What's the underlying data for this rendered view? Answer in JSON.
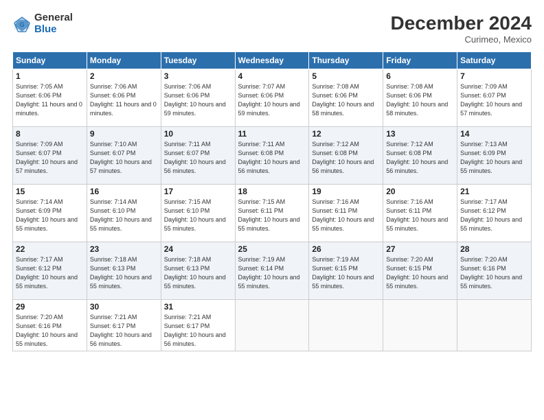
{
  "logo": {
    "general": "General",
    "blue": "Blue"
  },
  "header": {
    "month": "December 2024",
    "location": "Curimeo, Mexico"
  },
  "weekdays": [
    "Sunday",
    "Monday",
    "Tuesday",
    "Wednesday",
    "Thursday",
    "Friday",
    "Saturday"
  ],
  "weeks": [
    [
      {
        "day": "1",
        "sunrise": "7:05 AM",
        "sunset": "6:06 PM",
        "daylight": "11 hours and 0 minutes."
      },
      {
        "day": "2",
        "sunrise": "7:06 AM",
        "sunset": "6:06 PM",
        "daylight": "11 hours and 0 minutes."
      },
      {
        "day": "3",
        "sunrise": "7:06 AM",
        "sunset": "6:06 PM",
        "daylight": "10 hours and 59 minutes."
      },
      {
        "day": "4",
        "sunrise": "7:07 AM",
        "sunset": "6:06 PM",
        "daylight": "10 hours and 59 minutes."
      },
      {
        "day": "5",
        "sunrise": "7:08 AM",
        "sunset": "6:06 PM",
        "daylight": "10 hours and 58 minutes."
      },
      {
        "day": "6",
        "sunrise": "7:08 AM",
        "sunset": "6:06 PM",
        "daylight": "10 hours and 58 minutes."
      },
      {
        "day": "7",
        "sunrise": "7:09 AM",
        "sunset": "6:07 PM",
        "daylight": "10 hours and 57 minutes."
      }
    ],
    [
      {
        "day": "8",
        "sunrise": "7:09 AM",
        "sunset": "6:07 PM",
        "daylight": "10 hours and 57 minutes."
      },
      {
        "day": "9",
        "sunrise": "7:10 AM",
        "sunset": "6:07 PM",
        "daylight": "10 hours and 57 minutes."
      },
      {
        "day": "10",
        "sunrise": "7:11 AM",
        "sunset": "6:07 PM",
        "daylight": "10 hours and 56 minutes."
      },
      {
        "day": "11",
        "sunrise": "7:11 AM",
        "sunset": "6:08 PM",
        "daylight": "10 hours and 56 minutes."
      },
      {
        "day": "12",
        "sunrise": "7:12 AM",
        "sunset": "6:08 PM",
        "daylight": "10 hours and 56 minutes."
      },
      {
        "day": "13",
        "sunrise": "7:12 AM",
        "sunset": "6:08 PM",
        "daylight": "10 hours and 56 minutes."
      },
      {
        "day": "14",
        "sunrise": "7:13 AM",
        "sunset": "6:09 PM",
        "daylight": "10 hours and 55 minutes."
      }
    ],
    [
      {
        "day": "15",
        "sunrise": "7:14 AM",
        "sunset": "6:09 PM",
        "daylight": "10 hours and 55 minutes."
      },
      {
        "day": "16",
        "sunrise": "7:14 AM",
        "sunset": "6:10 PM",
        "daylight": "10 hours and 55 minutes."
      },
      {
        "day": "17",
        "sunrise": "7:15 AM",
        "sunset": "6:10 PM",
        "daylight": "10 hours and 55 minutes."
      },
      {
        "day": "18",
        "sunrise": "7:15 AM",
        "sunset": "6:11 PM",
        "daylight": "10 hours and 55 minutes."
      },
      {
        "day": "19",
        "sunrise": "7:16 AM",
        "sunset": "6:11 PM",
        "daylight": "10 hours and 55 minutes."
      },
      {
        "day": "20",
        "sunrise": "7:16 AM",
        "sunset": "6:11 PM",
        "daylight": "10 hours and 55 minutes."
      },
      {
        "day": "21",
        "sunrise": "7:17 AM",
        "sunset": "6:12 PM",
        "daylight": "10 hours and 55 minutes."
      }
    ],
    [
      {
        "day": "22",
        "sunrise": "7:17 AM",
        "sunset": "6:12 PM",
        "daylight": "10 hours and 55 minutes."
      },
      {
        "day": "23",
        "sunrise": "7:18 AM",
        "sunset": "6:13 PM",
        "daylight": "10 hours and 55 minutes."
      },
      {
        "day": "24",
        "sunrise": "7:18 AM",
        "sunset": "6:13 PM",
        "daylight": "10 hours and 55 minutes."
      },
      {
        "day": "25",
        "sunrise": "7:19 AM",
        "sunset": "6:14 PM",
        "daylight": "10 hours and 55 minutes."
      },
      {
        "day": "26",
        "sunrise": "7:19 AM",
        "sunset": "6:15 PM",
        "daylight": "10 hours and 55 minutes."
      },
      {
        "day": "27",
        "sunrise": "7:20 AM",
        "sunset": "6:15 PM",
        "daylight": "10 hours and 55 minutes."
      },
      {
        "day": "28",
        "sunrise": "7:20 AM",
        "sunset": "6:16 PM",
        "daylight": "10 hours and 55 minutes."
      }
    ],
    [
      {
        "day": "29",
        "sunrise": "7:20 AM",
        "sunset": "6:16 PM",
        "daylight": "10 hours and 55 minutes."
      },
      {
        "day": "30",
        "sunrise": "7:21 AM",
        "sunset": "6:17 PM",
        "daylight": "10 hours and 56 minutes."
      },
      {
        "day": "31",
        "sunrise": "7:21 AM",
        "sunset": "6:17 PM",
        "daylight": "10 hours and 56 minutes."
      },
      {
        "day": "",
        "sunrise": "",
        "sunset": "",
        "daylight": ""
      },
      {
        "day": "",
        "sunrise": "",
        "sunset": "",
        "daylight": ""
      },
      {
        "day": "",
        "sunrise": "",
        "sunset": "",
        "daylight": ""
      },
      {
        "day": "",
        "sunrise": "",
        "sunset": "",
        "daylight": ""
      }
    ]
  ],
  "labels": {
    "sunrise": "Sunrise:",
    "sunset": "Sunset:",
    "daylight": "Daylight:"
  }
}
